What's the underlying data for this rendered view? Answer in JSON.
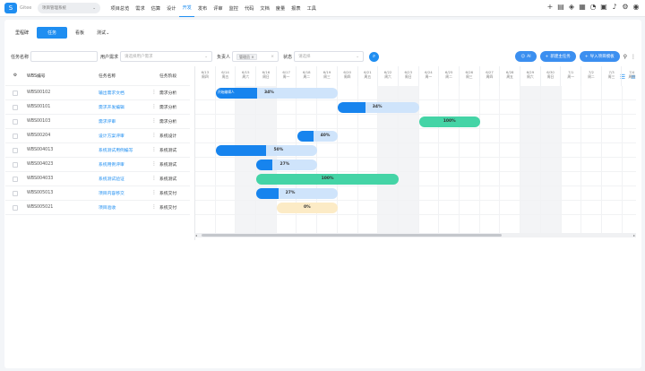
{
  "topbar": {
    "logo_text": "S",
    "brand": "Gitee",
    "project": "项目管理系统",
    "nav": [
      "项目总览",
      "需求",
      "估算",
      "设计",
      "开发",
      "发布",
      "评审",
      "监控",
      "代码",
      "文档",
      "度量",
      "报表",
      "工具"
    ],
    "active_nav": 4
  },
  "tabs": [
    "里程碑",
    "任务",
    "看板",
    "测试"
  ],
  "active_tab": 1,
  "filters": {
    "task_name_label": "任务名称",
    "user_req_label": "用户需求",
    "user_req_placeholder": "请选择用户需求",
    "owner_label": "负责人",
    "owner_tag": "管理员",
    "status_label": "状态",
    "status_placeholder": "请选择"
  },
  "actions": {
    "ai_label": "AI",
    "new_task_label": "新建主任务",
    "import_label": "导入项目模板"
  },
  "grid": {
    "columns": [
      "WBS编号",
      "任务名称",
      "任务阶段"
    ],
    "rows": [
      {
        "code": "WBS00102",
        "name": "输出需求文档",
        "stage": "需求分析"
      },
      {
        "code": "WBS00101",
        "name": "需求开发编辑",
        "stage": "需求分析"
      },
      {
        "code": "WBS00103",
        "name": "需求评审",
        "stage": "需求分析"
      },
      {
        "code": "WBS00204",
        "name": "设计方案评审",
        "stage": "系统设计"
      },
      {
        "code": "WBS004013",
        "name": "系统测试用例编写",
        "stage": "系统测试"
      },
      {
        "code": "WBS004023",
        "name": "系统用例评审",
        "stage": "系统测试"
      },
      {
        "code": "WBS004033",
        "name": "系统测试验证",
        "stage": "系统测试"
      },
      {
        "code": "WBS005013",
        "name": "项目内容移交",
        "stage": "系统交付"
      },
      {
        "code": "WBS005021",
        "name": "项目验收",
        "stage": "系统交付"
      }
    ]
  },
  "gantt": {
    "dates": [
      {
        "d": "6/13",
        "w": "周四"
      },
      {
        "d": "6/14",
        "w": "周五"
      },
      {
        "d": "6/15",
        "w": "周六"
      },
      {
        "d": "6/16",
        "w": "周日"
      },
      {
        "d": "6/17",
        "w": "周一"
      },
      {
        "d": "6/18",
        "w": "周二"
      },
      {
        "d": "6/19",
        "w": "周三"
      },
      {
        "d": "6/20",
        "w": "周四"
      },
      {
        "d": "6/21",
        "w": "周五"
      },
      {
        "d": "6/22",
        "w": "周六"
      },
      {
        "d": "6/23",
        "w": "周日"
      },
      {
        "d": "6/24",
        "w": "周一"
      },
      {
        "d": "6/25",
        "w": "周二"
      },
      {
        "d": "6/26",
        "w": "周三"
      },
      {
        "d": "6/27",
        "w": "周四"
      },
      {
        "d": "6/28",
        "w": "周五"
      },
      {
        "d": "6/29",
        "w": "周六"
      },
      {
        "d": "6/30",
        "w": "周日"
      },
      {
        "d": "7/1",
        "w": "周一"
      },
      {
        "d": "7/2",
        "w": "周二"
      },
      {
        "d": "7/3",
        "w": "周三"
      },
      {
        "d": "7/4",
        "w": "周四"
      }
    ],
    "weekend_indices": [
      2,
      3,
      9,
      10,
      16,
      17
    ],
    "bars": [
      {
        "row": 0,
        "start": 1.0,
        "days": 6.0,
        "progress": 0.34,
        "label": "34%",
        "style": "blue",
        "name": "开始编辑人"
      },
      {
        "row": 1,
        "start": 7.0,
        "days": 4.0,
        "progress": 0.34,
        "label": "34%",
        "style": "blue"
      },
      {
        "row": 2,
        "start": 11.0,
        "days": 3.0,
        "progress": 1.0,
        "label": "100%",
        "style": "green"
      },
      {
        "row": 3,
        "start": 5.0,
        "days": 2.0,
        "progress": 0.4,
        "label": "40%",
        "style": "blue"
      },
      {
        "row": 4,
        "start": 1.0,
        "days": 5.0,
        "progress": 0.5,
        "label": "50%",
        "style": "blue"
      },
      {
        "row": 5,
        "start": 3.0,
        "days": 3.0,
        "progress": 0.27,
        "label": "27%",
        "style": "blue"
      },
      {
        "row": 6,
        "start": 3.0,
        "days": 7.0,
        "progress": 1.0,
        "label": "100%",
        "style": "green"
      },
      {
        "row": 7,
        "start": 3.0,
        "days": 4.0,
        "progress": 0.27,
        "label": "27%",
        "style": "blue"
      },
      {
        "row": 8,
        "start": 4.0,
        "days": 3.0,
        "progress": 0.0,
        "label": "0%",
        "style": "yellow"
      }
    ]
  },
  "colors": {
    "primary": "#1f8ef1",
    "bar_bg_blue": "#cfe4fb",
    "bar_fill_blue": "#1784ee",
    "bar_green": "#44d4a6",
    "bar_yellow": "#fcebc6"
  }
}
